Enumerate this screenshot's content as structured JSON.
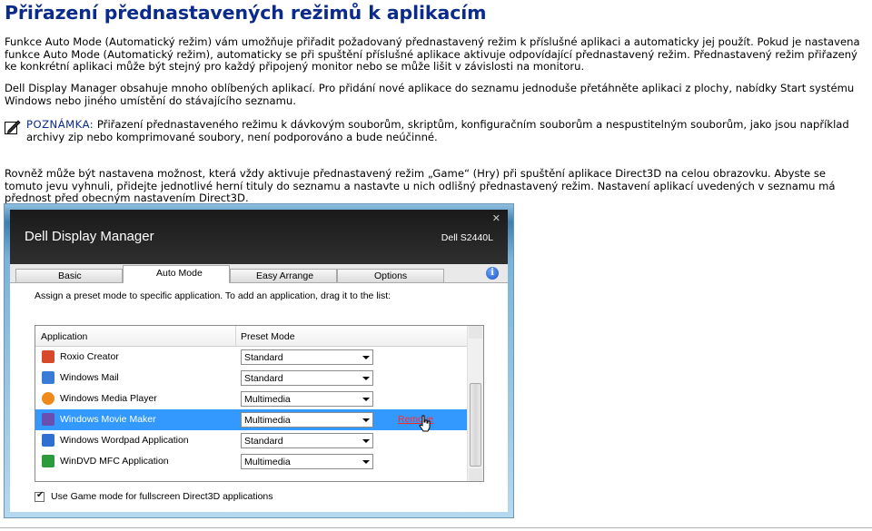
{
  "page": {
    "title": "Přiřazení přednastavených režimů k aplikacím",
    "para1": "Funkce Auto Mode (Automatický režim) vám umožňuje přiřadit požadovaný přednastavený režim k příslušné aplikaci a automaticky jej použít. Pokud je nastavena funkce Auto Mode (Automatický režim), automaticky se při spuštění příslušné aplikace aktivuje odpovídající přednastavený režim. Přednastavený režim přiřazený ke konkrétní aplikaci může být stejný pro každý připojený monitor nebo se může lišit v závislosti na monitoru.",
    "para2": "Dell Display Manager obsahuje mnoho oblíbených aplikací. Pro přidání nové aplikace do seznamu jednoduše přetáhněte aplikaci z plochy, nabídky Start systému Windows nebo jiného umístění do stávajícího seznamu.",
    "note_label": "POZNÁMKA:",
    "note_text": " Přiřazení přednastaveného režimu k dávkovým souborům, skriptům, konfiguračním souborům a nespustitelným souborům, jako jsou například archivy zip nebo komprimované soubory, není podporováno a bude neúčinné.",
    "para3": "Rovněž může být nastavena možnost, která vždy aktivuje přednastavený režim „Game“ (Hry) při spuštění aplikace Direct3D na celou obrazovku. Abyste se tomuto jevu vyhnuli, přidejte jednotlivé herní tituly do seznamu a nastavte u nich odlišný přednastavený režim. Nastavení aplikací uvedených v seznamu má přednost před obecným nastavením Direct3D."
  },
  "app": {
    "title": "Dell Display Manager",
    "monitor": "Dell S2440L",
    "close_glyph": "✕",
    "tabs": [
      {
        "label": "Basic"
      },
      {
        "label": "Auto Mode"
      },
      {
        "label": "Easy Arrange"
      },
      {
        "label": "Options"
      }
    ],
    "info_glyph": "i",
    "instruction": "Assign a preset mode to specific application. To add an application, drag it to the list:",
    "columns": {
      "application": "Application",
      "preset": "Preset Mode"
    },
    "rows": [
      {
        "name": "Roxio Creator",
        "mode": "Standard",
        "icon_color": "#d8492c"
      },
      {
        "name": "Windows Mail",
        "mode": "Standard",
        "icon_color": "#3a7bd5"
      },
      {
        "name": "Windows Media Player",
        "mode": "Multimedia",
        "icon_color": "#f08a1c"
      },
      {
        "name": "Windows Movie Maker",
        "mode": "Multimedia",
        "icon_color": "#6a4fb0",
        "selected": true,
        "action": "Remove"
      },
      {
        "name": "Windows Wordpad Application",
        "mode": "Standard",
        "icon_color": "#2f6fcf"
      },
      {
        "name": "WinDVD MFC Application",
        "mode": "Multimedia",
        "icon_color": "#2e9a3e"
      }
    ],
    "game_mode_label": "Use Game mode for fullscreen Direct3D applications",
    "game_mode_checked": true,
    "check_glyph": "✔"
  }
}
